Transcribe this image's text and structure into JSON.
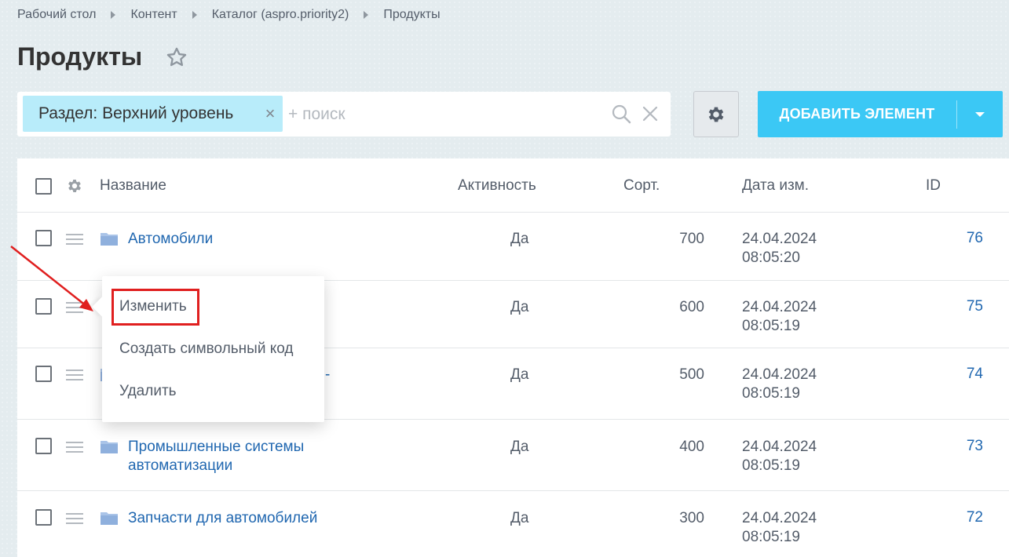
{
  "breadcrumb": [
    "Рабочий стол",
    "Контент",
    "Каталог (aspro.priority2)",
    "Продукты"
  ],
  "page": {
    "title": "Продукты"
  },
  "filter": {
    "chip_label": "Раздел: Верхний уровень",
    "chip_close": "×",
    "placeholder": "+ поиск",
    "value": ""
  },
  "toolbar": {
    "add_label": "ДОБАВИТЬ ЭЛЕМЕНТ"
  },
  "table": {
    "headers": {
      "name": "Название",
      "active": "Активность",
      "sort": "Сорт.",
      "date": "Дата изм.",
      "id": "ID"
    },
    "rows": [
      {
        "name": "Автомобили",
        "name2": "",
        "active": "Да",
        "sort": "700",
        "date": "24.04.2024",
        "time": "08:05:20",
        "id": "76"
      },
      {
        "name": "",
        "name2": "",
        "active": "Да",
        "sort": "600",
        "date": "24.04.2024",
        "time": "08:05:19",
        "id": "75"
      },
      {
        "name": "-",
        "name2": "",
        "active": "Да",
        "sort": "500",
        "date": "24.04.2024",
        "time": "08:05:19",
        "id": "74"
      },
      {
        "name": "Промышленные системы",
        "name2": "автоматизации",
        "active": "Да",
        "sort": "400",
        "date": "24.04.2024",
        "time": "08:05:19",
        "id": "73"
      },
      {
        "name": "Запчасти для автомобилей",
        "name2": "",
        "active": "Да",
        "sort": "300",
        "date": "24.04.2024",
        "time": "08:05:19",
        "id": "72"
      }
    ]
  },
  "context_menu": {
    "items": [
      "Изменить",
      "Создать символьный код",
      "Удалить"
    ]
  },
  "colors": {
    "accent": "#3bc8f5",
    "chip": "#b8ecfa",
    "link": "#2067b0",
    "annotation": "#e01f1f"
  },
  "icons": {
    "star": "star-icon",
    "search": "search-icon",
    "clear": "close-icon",
    "settings": "gear-icon",
    "drag": "drag-handle-icon",
    "folder": "folder-icon"
  }
}
